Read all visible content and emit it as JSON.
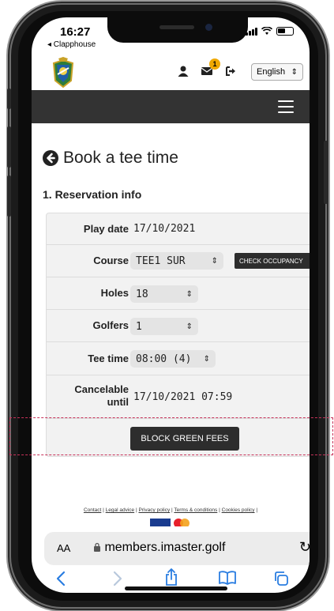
{
  "status_bar": {
    "time": "16:27",
    "back_app": "◂ Clapphouse"
  },
  "header": {
    "language": "English",
    "notification_count": "1"
  },
  "page": {
    "title": "Book a tee time",
    "section": "1. Reservation info"
  },
  "form": {
    "play_date_label": "Play date",
    "play_date_value": "17/10/2021",
    "course_label": "Course",
    "course_value": "TEE1 SUR",
    "check_button": "CHECK OCCUPANCY",
    "holes_label": "Holes",
    "holes_value": "18",
    "golfers_label": "Golfers",
    "golfers_value": "1",
    "tee_time_label": "Tee time",
    "tee_time_value": "08:00 (4)",
    "cancelable_label": "Cancelable until",
    "cancelable_value": "17/10/2021 07:59",
    "block_button": "BLOCK GREEN FEES"
  },
  "footer": {
    "links": [
      "Contact",
      "Legal advice",
      "Privacy policy",
      "Terms & conditions",
      "Cookies policy"
    ]
  },
  "browser": {
    "aa": "AA",
    "url": "members.imaster.golf"
  },
  "colors": {
    "dark_bar": "#333333",
    "badge": "#f0a800",
    "dashed_highlight": "#c8325a",
    "safari_blue": "#2a7de1"
  }
}
